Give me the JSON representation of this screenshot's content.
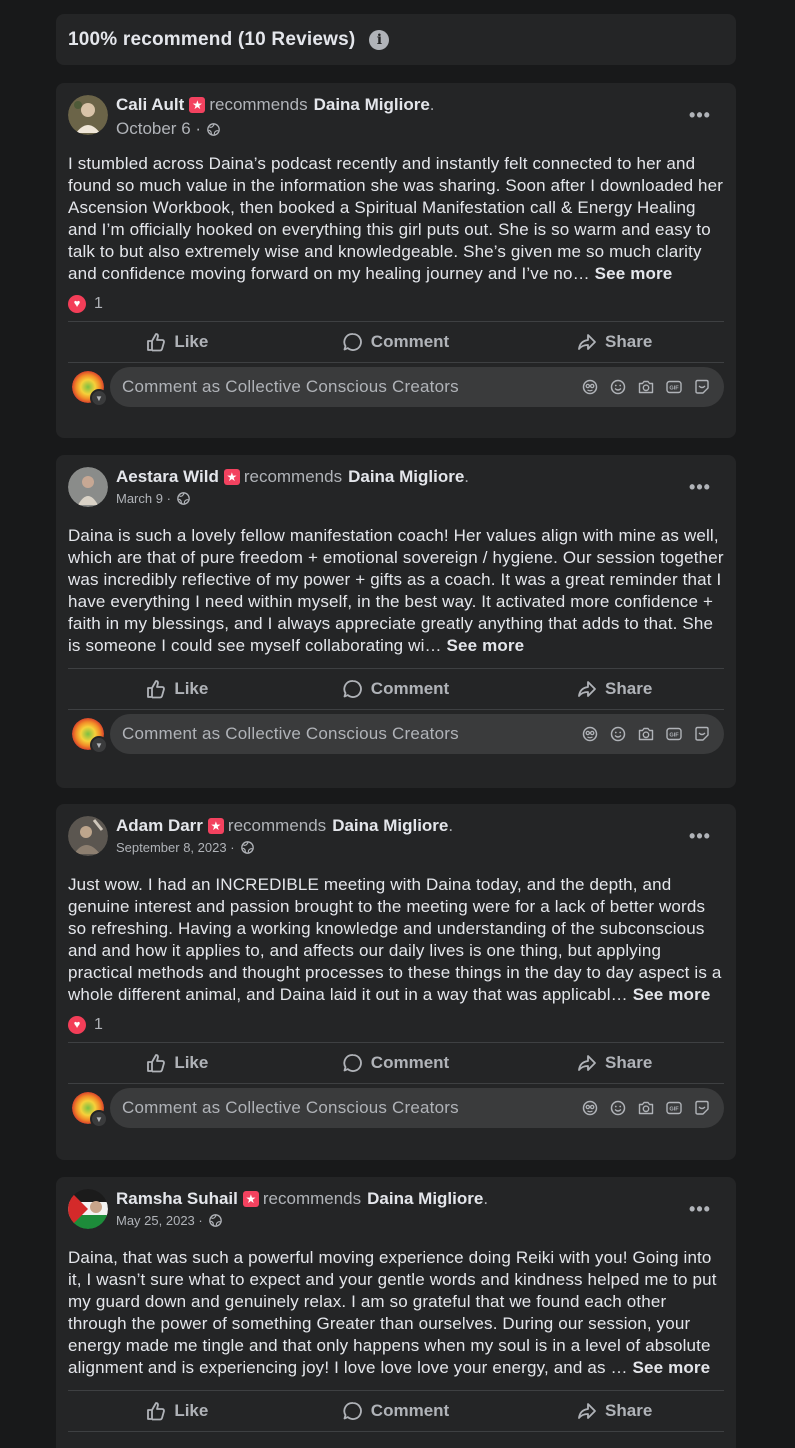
{
  "header": {
    "title": "100% recommend (10 Reviews)",
    "info_icon": "info-icon"
  },
  "labels": {
    "recommends": "recommends",
    "see_more": "See more",
    "like": "Like",
    "comment": "Comment",
    "share": "Share",
    "comment_placeholder": "Comment as Collective Conscious Creators",
    "more": "•••"
  },
  "colors": {
    "background": "#18191a",
    "card": "#242526",
    "input": "#3a3b3c",
    "text": "#e4e6eb",
    "secondary_text": "#b0b3b8",
    "recommend_badge": "#f3425f",
    "love_reaction": "#f33e58"
  },
  "reviews": [
    {
      "author": "Cali Ault",
      "target": "Daina Migliore",
      "date": "October 6 ·",
      "text": "I stumbled across Daina’s podcast recently and instantly felt connected to her and found so much value in the information she was sharing. Soon after I downloaded her Ascension Workbook, then booked a Spiritual Manifestation call & Energy Healing  and I’m officially hooked on everything this girl puts out. She is so warm and easy to talk to but also extremely wise and knowledgeable. She’s given me so much clarity and confidence moving forward on my healing journey and I’ve no…",
      "reactions": "1"
    },
    {
      "author": "Aestara Wild",
      "target": "Daina Migliore",
      "date": "March 9 ·",
      "text": "Daina is such a lovely fellow manifestation coach! Her values align with mine as well, which are that of pure freedom + emotional sovereign / hygiene. Our session together was incredibly reflective of my power + gifts as a coach. It was a great reminder that I have everything I need within myself, in the best way. It activated more confidence + faith in my blessings, and I always appreciate greatly anything that adds to that. She is someone I could see myself collaborating wi…"
    },
    {
      "author": "Adam Darr",
      "target": "Daina Migliore",
      "date": "September 8, 2023 ·",
      "text": "Just wow. I had an INCREDIBLE meeting with Daina today, and the depth, and genuine interest and passion brought to the meeting were for a lack of better words so refreshing. Having a working knowledge and understanding of the subconscious and and how it applies to, and affects our daily lives is one thing, but applying practical methods and thought processes to these things in the day to day aspect is a whole different animal, and Daina laid it out in a way that was applicabl…",
      "reactions": "1"
    },
    {
      "author": "Ramsha Suhail",
      "target": "Daina Migliore",
      "date": "May 25, 2023 ·",
      "text": "Daina, that was such a powerful moving experience doing Reiki with you! Going into it, I wasn’t sure what to expect and your gentle words and kindness helped me to put my guard down and genuinely relax. I am so grateful that we found each other through the power of something Greater than ourselves. During our session, your energy made me tingle and that only happens when my soul is in a level of absolute alignment and is experiencing joy! I love love love your energy, and as …"
    }
  ]
}
